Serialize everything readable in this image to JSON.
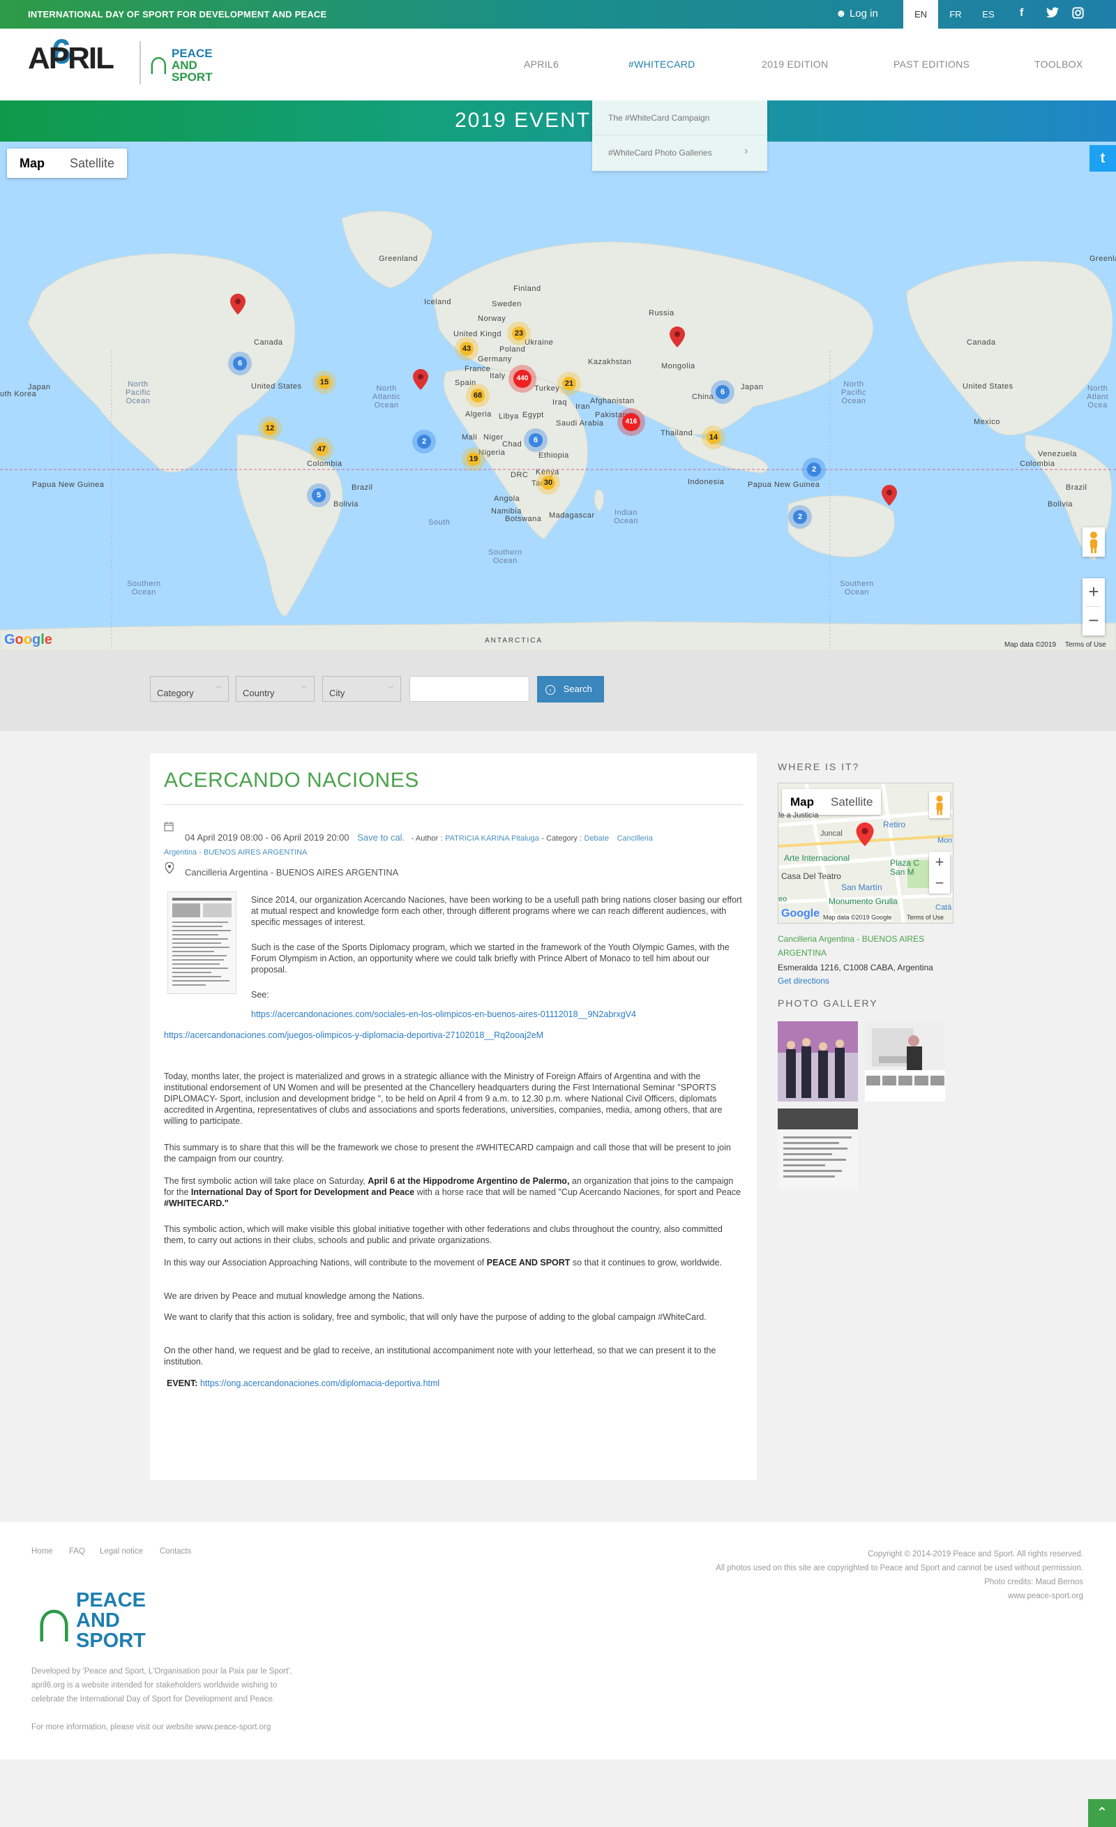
{
  "topbar": {
    "title": "INTERNATIONAL DAY OF SPORT FOR DEVELOPMENT AND PEACE",
    "login": "Log in",
    "languages": [
      "EN",
      "FR",
      "ES"
    ],
    "social_icons": [
      "facebook-icon",
      "twitter-icon",
      "instagram-icon"
    ]
  },
  "header": {
    "logo_april": "APRIL",
    "logo_six": "6",
    "logo_peace_1": "PEACE",
    "logo_peace_2": "AND",
    "logo_peace_3": "SPORT",
    "nav": [
      "APRIL6",
      "#WHITECARD",
      "2019 EDITION",
      "PAST EDITIONS",
      "TOOLBOX"
    ],
    "active_nav": "#WHITECARD",
    "dropdown": [
      "The #WhiteCard Campaign",
      "#WhiteCard Photo Galleries"
    ]
  },
  "banner": {
    "title": "2019 EVENTS MAP"
  },
  "map": {
    "type_buttons": [
      "Map",
      "Satellite"
    ],
    "labels": {
      "greenland": "Greenland",
      "greenland2": "Greenlan",
      "iceland": "Iceland",
      "finland": "Finland",
      "sweden": "Sweden",
      "norway": "Norway",
      "russia": "Russia",
      "canada": "Canada",
      "canada2": "Canada",
      "united_states": "United States",
      "united_states2": "United States",
      "mexico": "Mexico",
      "kazakhstan": "Kazakhstan",
      "mongolia": "Mongolia",
      "china": "China",
      "japan": "Japan",
      "japan2": "Japan",
      "south_korea": "uth Korea",
      "france": "France",
      "spain": "Spain",
      "germany": "Germany",
      "poland": "Poland",
      "ukraine": "Ukraine",
      "united_kingdom": "United Kingd",
      "italy": "Italy",
      "turkey": "Turkey",
      "iraq": "Iraq",
      "iran": "Iran",
      "afghanistan": "Afghanistan",
      "pakistan": "Pakistan",
      "algeria": "Algeria",
      "libya": "Libya",
      "egypt": "Egypt",
      "saudi_arabia": "Saudi Arabia",
      "mali": "Mali",
      "niger": "Niger",
      "chad": "Chad",
      "nigeria": "Nigeria",
      "ethiopia": "Ethiopia",
      "drc": "DRC",
      "kenya": "Kenya",
      "tanzania": "Tan",
      "angola": "Angola",
      "namibia": "Namibia",
      "botswana": "Botswana",
      "madagascar": "Madagascar",
      "thailand": "Thailand",
      "indonesia": "Indonesia",
      "papua": "Papua New\nGuinea",
      "papua2": "Papua New\nGuinea",
      "colombia": "Colombia",
      "colombia2": "Colombia",
      "venezuela": "Venezuela",
      "brazil": "Brazil",
      "brazil2": "Brazil",
      "bolivia": "Bolivia",
      "bolivia2": "Bolivia",
      "antarctica": "ANTARCTICA"
    },
    "oceans": {
      "np": "North\nPacific\nOcean",
      "np2": "North\nPacific\nOcean",
      "na": "North\nAtlantic\nOcean",
      "na2": "North\nAtlant\nOcea",
      "io": "Indian\nOcean",
      "so": "Southern\nOcean",
      "so2": "Southern\nOcean",
      "so3": "Southern\nOcean",
      "so4": "South"
    },
    "clusters": [
      "6",
      "15",
      "12",
      "47",
      "5",
      "43",
      "23",
      "440",
      "21",
      "68",
      "2",
      "19",
      "6",
      "30",
      "6",
      "416",
      "14",
      "2",
      "2"
    ],
    "google": "Google",
    "map_footer": "Map data ©2019",
    "terms": "Terms of Use"
  },
  "filters": {
    "category": "Category",
    "country": "Country",
    "city": "City",
    "search_value": "",
    "search_button": "Search"
  },
  "event": {
    "title": "ACERCANDO NACIONES",
    "dates": "04 April 2019 08:00 - 06 April 2019 20:00",
    "save": "Save to cal.",
    "author_label": "- Author :",
    "author": "PATRICIA KARINA Pitaluga",
    "category_label": "- Category :",
    "category": "Debate",
    "place_link_1": "Cancilleria",
    "place_link_2": "Argentina - BUENOS AIRES ARGENTINA",
    "location": "Cancilleria Argentina - BUENOS AIRES ARGENTINA",
    "p1": "Since 2014,  our organization Acercando Naciones, have been working to be a usefull path bring nations closer basing our effort at mutual respect and knowledge form each other, through different programs where we can reach different audiences, with specific messages of interest.",
    "p2": "Such is the case of the Sports Diplomacy program, which we started in the framework of the Youth Olympic Games, with the Forum Olympism in Action, an opportunity where we could talk briefly with Prince Albert of Monaco to tell him about our proposal.",
    "see": "See:",
    "url1": "https://acercandonaciones.com/sociales-en-los-olimpicos-en-buenos-aires-01112018__9N2abrxgV4",
    "url2": "https://acercandonaciones.com/juegos-olimpicos-y-diplomacia-deportiva-27102018__Rq2ooaj2eM",
    "p3": "Today, months later, the project is materialized and grows in a strategic alliance with the Ministry of Foreign Affairs of Argentina and with the institutional endorsement of UN Women and will be presented at the Chancellery headquarters during the First International Seminar \"SPORTS DIPLOMACY- Sport, inclusion and development bridge \", to be held on April 4 from 9 a.m. to 12.30 p.m. where National Civil Officers, diplomats accredited in Argentina, representatives of clubs and associations and sports federations, universities, companies, media, among others, that are willing to participate.",
    "p4": "This summary is to share that this will be the framework we chose to present the #WHITECARD campaign and call those that will be present to join the campaign from our country.",
    "p5a": "The first symbolic action will take place on Saturday, ",
    "p5b": "April 6 at the Hippodrome Argentino de Palermo,",
    "p5c": " an organization that joins to the campaign for the ",
    "p5d": "International Day of Sport for Development and Peace",
    "p5e": " with a horse race that will be named \"Cup Acercando Naciones, for sport and Peace ",
    "p5f": "#WHITECARD.\"",
    "p6": "This symbolic action, which will make visible this global initiative together with other federations and clubs throughout the country, also committed them, to carry out actions in their clubs, schools and public and private organizations.",
    "p7a": "In this way our Association Approaching Nations, will contribute to the movement of ",
    "p7b": "PEACE AND SPORT",
    "p7c": " so that it continues to grow, worldwide.",
    "p8": "We are driven by Peace and mutual knowledge among the Nations.",
    "p9": "We want to clarify that this action is solidary, free and symbolic, that will only have the purpose of adding to the global campaign #WhiteCard.",
    "p10": "On the other hand, we request and be glad to receive, an institutional accompaniment note with your letterhead, so that we can present it to the institution.",
    "event_label": "EVENT:",
    "event_url": "https://ong.acercandonaciones.com/diplomacia-deportiva.html"
  },
  "sidebar": {
    "where_title": "WHERE IS IT?",
    "map_buttons": [
      "Map",
      "Satellite"
    ],
    "map_labels": [
      "Retiro",
      "Juncal",
      "Arte Internacional",
      "Plaza C San M",
      "Casa Del Teatro",
      "San Martín",
      "Monumento Grulla",
      "Catá",
      "Mon",
      "tiro",
      "le a Justicia",
      "eo"
    ],
    "map_data": "Map data ©2019 Google",
    "map_terms": "Terms of Use",
    "place": "Cancilleria Argentina - BUENOS AIRES ARGENTINA",
    "address": "Esmeralda 1216, C1008 CABA, Argentina",
    "directions": "Get directions",
    "gallery_title": "PHOTO GALLERY"
  },
  "footer": {
    "links": [
      "Home",
      "FAQ",
      "Legal notice",
      "Contacts"
    ],
    "copyright": "Copyright © 2014-2019 Peace and Sport. All rights reserved.",
    "photos": "All photos used on this site are copyrighted to Peace and Sport and cannot be used without permission.",
    "credits": "Photo credits: Maud Bernos",
    "site": "www.peace-sport.org",
    "logo_1": "PEACE",
    "logo_2": "AND",
    "logo_3": "SPORT",
    "dev1": "Developed by 'Peace and Sport, L'Organisation pour la Paix par le Sport',",
    "dev2": "april6.org is a website intended for stakeholders worldwide wishing to",
    "dev3": "celebrate the International Day of Sport for Development and Peace.",
    "more": "For more information, please visit our website www.peace-sport.org"
  },
  "colors": {
    "green": "#2e9b47",
    "blue": "#1e7fb0",
    "title_green": "#4aa24c"
  }
}
